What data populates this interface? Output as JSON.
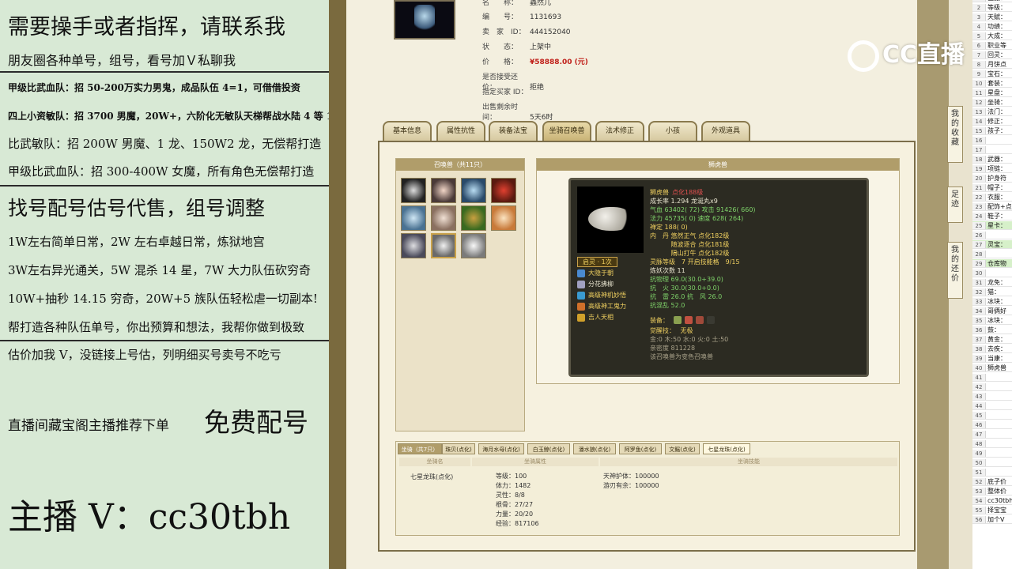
{
  "left_panel": {
    "lines": [
      "需要操手或者指挥，请联系我",
      "朋友圈各种单号，组号，看号加Ｖ私聊我",
      "甲级比武血队：招 50-200万实力男鬼，成品队伍 4=1，可借借投资",
      "四上小资敏队：招 3700 男魔，20W+，六阶化无敏队天梯帮战水陆 4 等 1",
      "比武敏队：招 200W 男魔、1 龙、150W2 龙，无偿帮打造",
      "甲级比武血队：招 300-400W 女魔，所有角色无偿帮打造",
      "找号配号估号代售，组号调整",
      "1W左右简单日常，2W 左右卓越日常，炼狱地宫",
      "3W左右异光通关，5W 混杀 14 星，7W 大力队伍砍穷奇",
      "10W+抽秒 14.15 穷奇，20W+5 族队伍轻松虐一切副本!",
      "帮打造各种队伍单号，你出预算和想法，我帮你做到极致",
      "估价加我 V，没链接上号估，列明细买号卖号不吃亏",
      "直播间藏宝阁主播推荐下单",
      "免费配号",
      "主播 V：cc30tbh"
    ]
  },
  "listing": {
    "fields": [
      {
        "key": "名　　称：",
        "value": "蟲然儿",
        "red": false
      },
      {
        "key": "编　　号：",
        "value": "1131693",
        "red": false
      },
      {
        "key": "卖　家　ID：",
        "value": "444152040",
        "red": false
      },
      {
        "key": "状　　态：",
        "value": "上架中",
        "red": false
      },
      {
        "key": "价　　格：",
        "value": "¥58888.00 (元)",
        "red": true
      },
      {
        "key": "是否接受还价：",
        "value": "拒绝",
        "red": false
      },
      {
        "key": "指定买家 ID：",
        "value": "",
        "red": false
      },
      {
        "key": "出售剩余时间：",
        "value": "5天6时",
        "red": false
      }
    ]
  },
  "tabs": [
    "基本信息",
    "属性抗性",
    "装备法宝",
    "坐骑召唤兽",
    "法术修正",
    "小孩",
    "外观道具"
  ],
  "summon_list": {
    "title": "召唤兽（共11只）"
  },
  "pet": {
    "header": "狮虎兽",
    "name": "狮虎兽",
    "name_suffix": "点化188级",
    "growth": "成长率 1.294  龙涎丸x9",
    "hp": "气血 63402( 72) 攻击 91426( 660)",
    "mp": "法力 45735( 0) 速度 628( 264)",
    "zen": "禅定 188( 0)",
    "dan1": "内　丹  悠然正气  点化182级",
    "dan2": "　　　  随波逐合  点化181级",
    "dan3": "　　　  隔山打牛  点化182级",
    "qiling": "启灵 · 1次",
    "level": "灵脉等级　7 开启技能格　9/15",
    "attack_count": "炼妖次数 11",
    "skills": [
      "大隐于朝",
      "分花拂柳",
      "高级神机妙悟",
      "高级神工鬼力",
      "吉人天相"
    ],
    "res1": "抗物理 69.0(30.0+39.0)",
    "res2": "抗　火 30.0(30.0+0.0)",
    "res3": "抗　雷 26.0 抗　风 26.0",
    "res4": "抗混乱 52.0",
    "equip_label": "装备：",
    "awake": "觉醒技：　 无极",
    "elements": "金:0 木:50 水:0 火:0 土:50",
    "closeness": "亲密度 811228",
    "note": "该召唤兽为变色召唤兽"
  },
  "mounts": {
    "tabs": [
      "坐骑（共7只）",
      "珠贝(点化)",
      "海月水母(点化)",
      "白玉鲸(点化)",
      "潘水狼(点化)",
      "阿罗鱼(点化)",
      "文鳐(点化)",
      "七星龙珠(点化)"
    ],
    "col_headers": [
      "坐骑名",
      "坐骑属性",
      "坐骑技能"
    ],
    "name": "七星龙珠(点化)",
    "stats": [
      "等级：100",
      "体力：1482",
      "灵性：8/8",
      "根骨：27/27",
      "力量：20/20",
      "经验：817106"
    ],
    "skills": [
      "天神护体：100000",
      "游刃有余：100000"
    ]
  },
  "watermark": {
    "text": "CC直播"
  },
  "side_tabs": [
    {
      "label": "我的收藏"
    },
    {
      "label": "足迹"
    },
    {
      "label": "我的还价"
    }
  ],
  "sheet": {
    "rows": [
      {
        "n": "1",
        "t": "区服："
      },
      {
        "n": "2",
        "t": "等级："
      },
      {
        "n": "3",
        "t": "天赋："
      },
      {
        "n": "4",
        "t": "功绩："
      },
      {
        "n": "5",
        "t": "大成："
      },
      {
        "n": "6",
        "t": "职业等"
      },
      {
        "n": "7",
        "t": "回灵："
      },
      {
        "n": "8",
        "t": "月饼点"
      },
      {
        "n": "9",
        "t": "宝石："
      },
      {
        "n": "10",
        "t": "套装："
      },
      {
        "n": "11",
        "t": "星盘："
      },
      {
        "n": "12",
        "t": "坐骑："
      },
      {
        "n": "13",
        "t": "法门："
      },
      {
        "n": "14",
        "t": "修正："
      },
      {
        "n": "15",
        "t": "孩子："
      },
      {
        "n": "16",
        "t": ""
      },
      {
        "n": "17",
        "t": ""
      },
      {
        "n": "18",
        "t": "武器："
      },
      {
        "n": "19",
        "t": "项链："
      },
      {
        "n": "20",
        "t": "护身符"
      },
      {
        "n": "21",
        "t": "帽子："
      },
      {
        "n": "22",
        "t": "衣服："
      },
      {
        "n": "23",
        "t": "配饰+点"
      },
      {
        "n": "24",
        "t": "鞋子："
      },
      {
        "n": "25",
        "t": "星卡：",
        "hl": true
      },
      {
        "n": "26",
        "t": ""
      },
      {
        "n": "27",
        "t": "灵宝：",
        "hl": true
      },
      {
        "n": "28",
        "t": ""
      },
      {
        "n": "29",
        "t": "仓库物",
        "hl": true
      },
      {
        "n": "30",
        "t": ""
      },
      {
        "n": "31",
        "t": "龙免："
      },
      {
        "n": "32",
        "t": "猫："
      },
      {
        "n": "33",
        "t": "冰块："
      },
      {
        "n": "34",
        "t": "哥俩好"
      },
      {
        "n": "35",
        "t": "冰块："
      },
      {
        "n": "36",
        "t": "鼓："
      },
      {
        "n": "37",
        "t": "黄金："
      },
      {
        "n": "38",
        "t": "去疾："
      },
      {
        "n": "39",
        "t": "当康："
      },
      {
        "n": "40",
        "t": "狮虎兽"
      },
      {
        "n": "41",
        "t": ""
      },
      {
        "n": "42",
        "t": ""
      },
      {
        "n": "43",
        "t": ""
      },
      {
        "n": "44",
        "t": ""
      },
      {
        "n": "45",
        "t": ""
      },
      {
        "n": "46",
        "t": ""
      },
      {
        "n": "47",
        "t": ""
      },
      {
        "n": "48",
        "t": ""
      },
      {
        "n": "49",
        "t": ""
      },
      {
        "n": "50",
        "t": ""
      },
      {
        "n": "51",
        "t": ""
      },
      {
        "n": "52",
        "t": "底子价"
      },
      {
        "n": "53",
        "t": "整体价"
      },
      {
        "n": "54",
        "t": "cc30tbh"
      },
      {
        "n": "55",
        "t": "择宝宝"
      },
      {
        "n": "56",
        "t": "加个V"
      }
    ]
  }
}
